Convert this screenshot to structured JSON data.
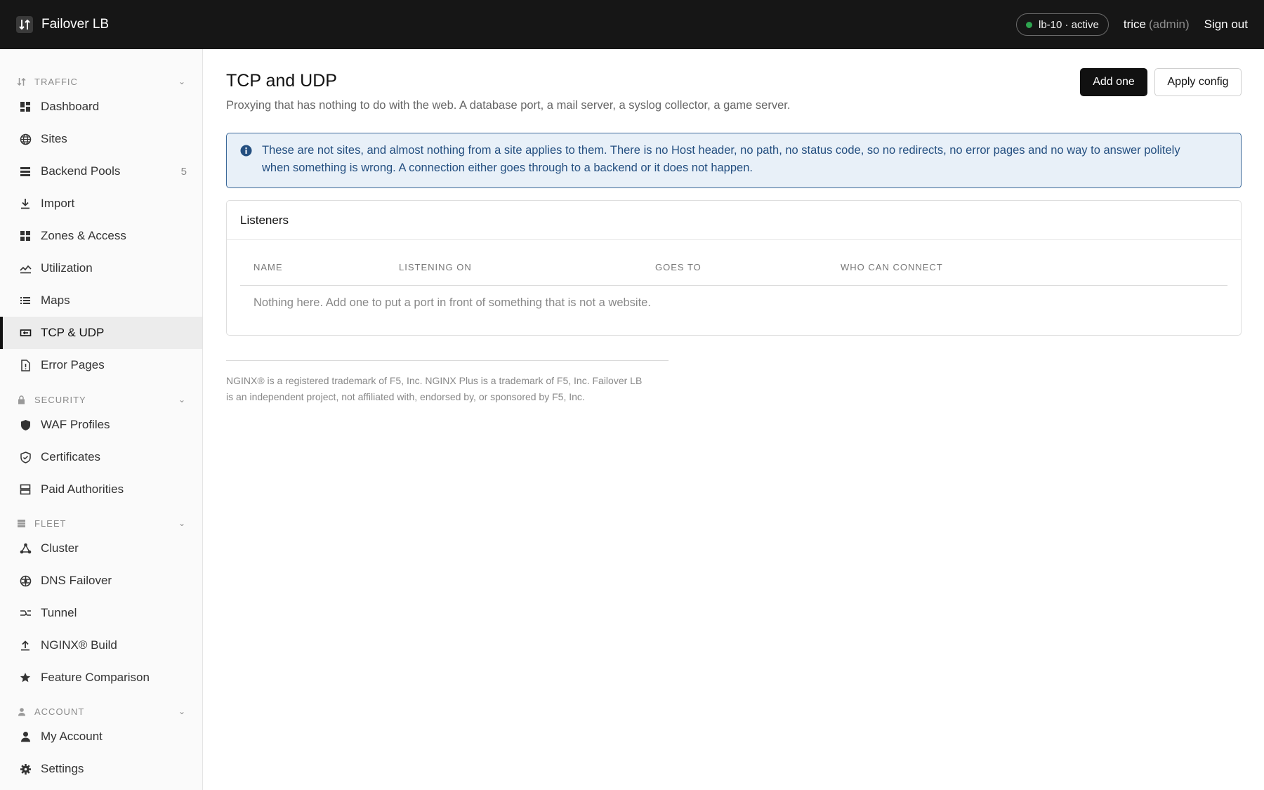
{
  "header": {
    "app_name": "Failover LB",
    "status": "lb-10 · active",
    "status_color": "#2ea44f",
    "user": "trice",
    "role": "(admin)",
    "signout": "Sign out"
  },
  "sidebar": {
    "sections": [
      {
        "label": "TRAFFIC",
        "icon": "arrows-updown-icon"
      },
      {
        "label": "SECURITY",
        "icon": "lock-icon"
      },
      {
        "label": "FLEET",
        "icon": "server-icon"
      },
      {
        "label": "ACCOUNT",
        "icon": "person-icon"
      }
    ],
    "items": [
      {
        "label": "Dashboard",
        "icon": "dashboard-icon"
      },
      {
        "label": "Sites",
        "icon": "globe-icon"
      },
      {
        "label": "Backend Pools",
        "icon": "stack-icon",
        "badge": "5"
      },
      {
        "label": "Import",
        "icon": "download-icon"
      },
      {
        "label": "Zones & Access",
        "icon": "grid-icon"
      },
      {
        "label": "Utilization",
        "icon": "chart-line-icon"
      },
      {
        "label": "Maps",
        "icon": "list-icon"
      },
      {
        "label": "TCP & UDP",
        "icon": "plug-icon",
        "active": true
      },
      {
        "label": "Error Pages",
        "icon": "file-alert-icon"
      },
      {
        "label": "WAF Profiles",
        "icon": "shield-icon"
      },
      {
        "label": "Certificates",
        "icon": "shield-check-icon"
      },
      {
        "label": "Paid Authorities",
        "icon": "database-icon"
      },
      {
        "label": "Cluster",
        "icon": "cluster-icon"
      },
      {
        "label": "DNS Failover",
        "icon": "globe-network-icon"
      },
      {
        "label": "Tunnel",
        "icon": "tunnel-icon"
      },
      {
        "label": "NGINX® Build",
        "icon": "upload-icon"
      },
      {
        "label": "Feature Comparison",
        "icon": "star-icon"
      },
      {
        "label": "My Account",
        "icon": "user-icon"
      },
      {
        "label": "Settings",
        "icon": "gear-icon"
      }
    ]
  },
  "main": {
    "title": "TCP and UDP",
    "subtitle": "Proxying that has nothing to do with the web. A database port, a mail server, a syslog collector, a game server.",
    "add_button": "Add one",
    "apply_button": "Apply config",
    "info_line1": "These are not sites, and almost nothing from a site applies to them. There is no Host header, no path, no status code, so no redirects, no error pages and no way to answer politely",
    "info_line2": "when something is wrong. A connection either goes through to a backend or it does not happen.",
    "panel_title": "Listeners",
    "columns": [
      "NAME",
      "LISTENING ON",
      "GOES TO",
      "WHO CAN CONNECT"
    ],
    "empty_text": "Nothing here. Add one to put a port in front of something that is not a website.",
    "footer_line1": "NGINX® is a registered trademark of F5, Inc. NGINX Plus is a trademark of F5, Inc. Failover LB",
    "footer_line2": "is an independent project, not affiliated with, endorsed by, or sponsored by F5, Inc."
  }
}
